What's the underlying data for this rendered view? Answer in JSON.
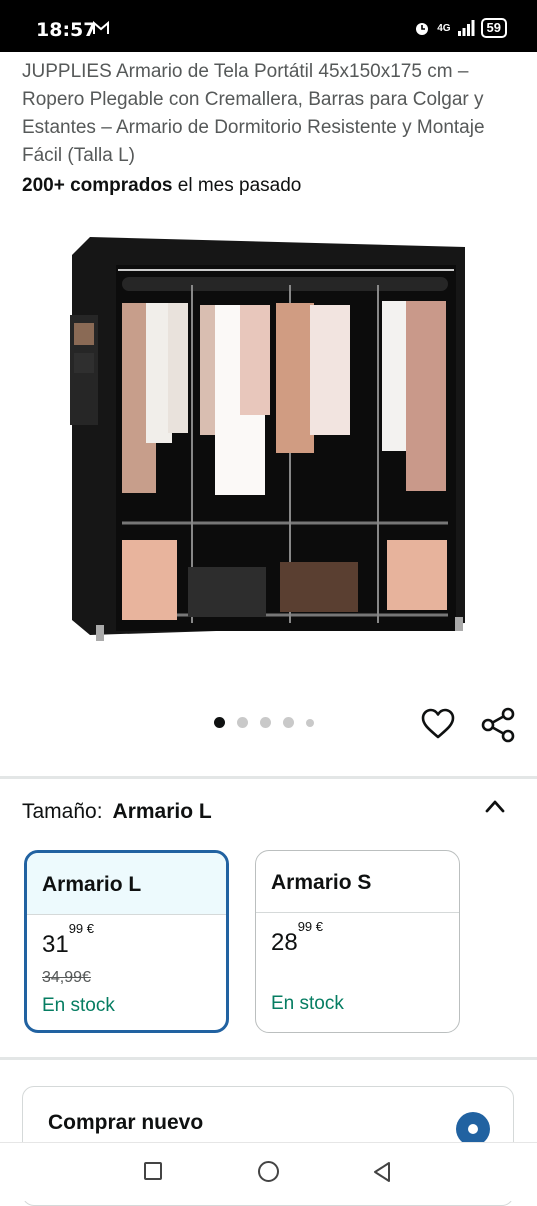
{
  "status_bar": {
    "time": "18:57",
    "network": "4G",
    "battery": "59"
  },
  "product": {
    "title": "JUPPLIES Armario de Tela Portátil 45x150x175 cm – Ropero Plegable con Cremallera, Barras para Colgar y Estantes – Armario de Dormitorio Resistente y Montaje Fácil (Talla L)",
    "bought_bold": "200+ comprados",
    "bought_rest": " el mes pasado"
  },
  "gallery": {
    "image_count": 5,
    "active_index": 0
  },
  "size": {
    "label": "Tamaño:",
    "selected": "Armario L",
    "options": [
      {
        "name": "Armario L",
        "price_whole": "31",
        "price_fraction": "99",
        "currency": "€",
        "old_price": "34,99€",
        "stock": "En stock"
      },
      {
        "name": "Armario S",
        "price_whole": "28",
        "price_fraction": "99",
        "currency": "€",
        "old_price": "",
        "stock": "En stock"
      }
    ]
  },
  "buy": {
    "label": "Comprar nuevo"
  },
  "colors": {
    "accent": "#2162a1",
    "stock_green": "#067d62",
    "selected_bg": "#edfafd"
  }
}
